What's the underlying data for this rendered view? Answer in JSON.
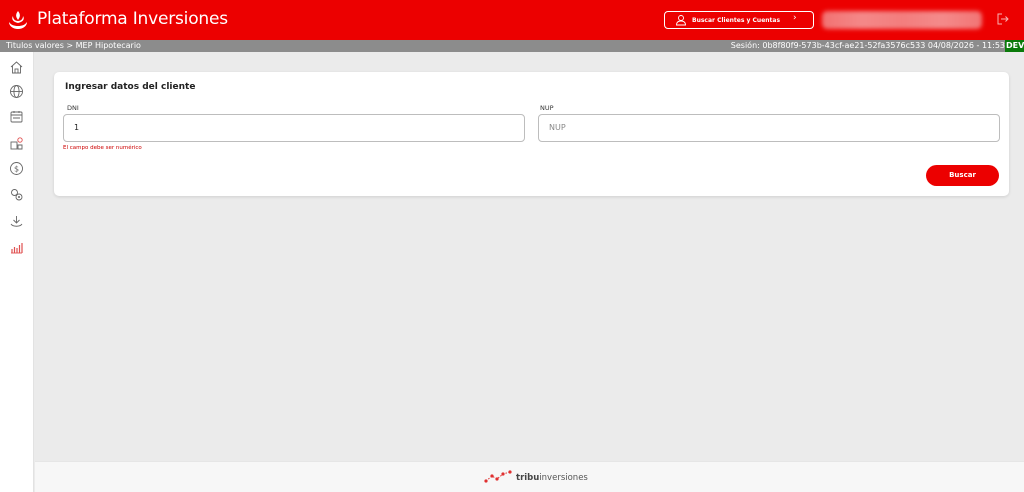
{
  "header": {
    "app_title": "Plataforma Inversiones",
    "search_clients_label": "Buscar Clientes y Cuentas",
    "brand_color": "#ec0000",
    "icons": [
      "santander-flame-icon",
      "user-icon",
      "chevron-right-icon",
      "logout-icon"
    ]
  },
  "infobar": {
    "breadcrumb": "Titulos valores > MEP Hipotecario",
    "session": "Sesión: 0b8f80f9-573b-43cf-ae21-52fa3576c533 04/08/2026 - 11:53",
    "env": "DEV",
    "env_color": "#0a7a0a"
  },
  "sidebar": {
    "items": [
      {
        "icon": "home-icon"
      },
      {
        "icon": "globe-icon"
      },
      {
        "icon": "calendar-icon"
      },
      {
        "icon": "exchange-icon"
      },
      {
        "icon": "dollar-icon"
      },
      {
        "icon": "settings-icon"
      },
      {
        "icon": "download-icon"
      },
      {
        "icon": "chart-icon",
        "active": true
      }
    ]
  },
  "form": {
    "title": "Ingresar datos del cliente",
    "dni_label": "DNI",
    "dni_value": "1",
    "nup_label": "NUP",
    "nup_placeholder": "NUP",
    "error_message": "El campo debe ser numérico",
    "submit_label": "Buscar"
  },
  "footer": {
    "brand_bold": "tribu",
    "brand_rest": "inversiones"
  }
}
